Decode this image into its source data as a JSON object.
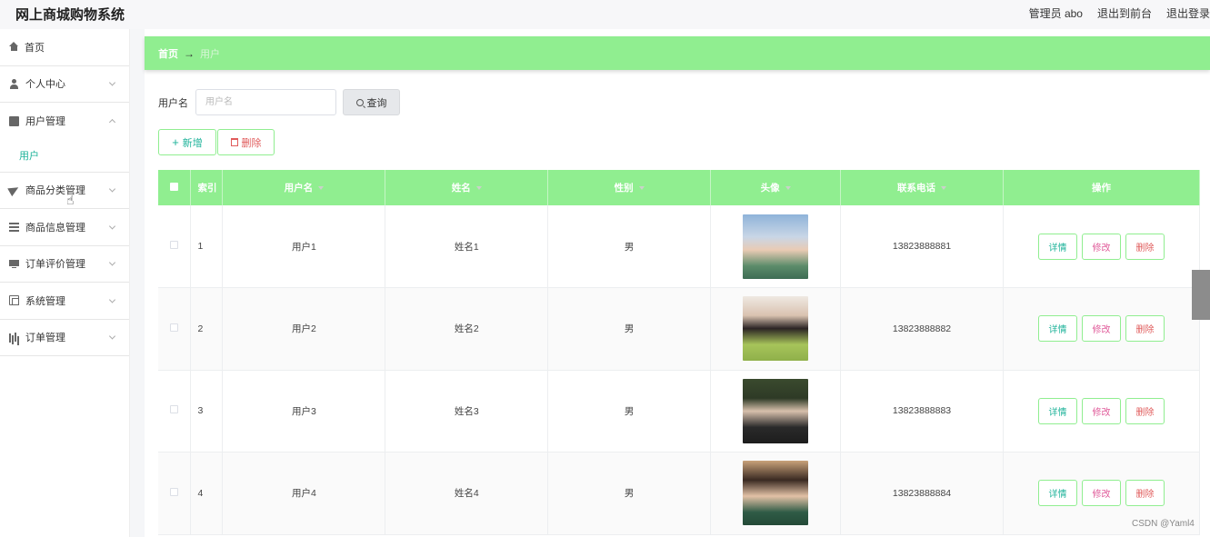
{
  "app": {
    "title": "网上商城购物系统"
  },
  "header": {
    "user": "管理员 abo",
    "to_front": "退出到前台",
    "logout": "退出登录"
  },
  "sidebar": {
    "items": [
      {
        "label": "首页",
        "icon": "home-icon"
      },
      {
        "label": "个人中心",
        "icon": "user-icon"
      },
      {
        "label": "用户管理",
        "icon": "box-icon",
        "expanded": true,
        "sub": [
          "用户"
        ]
      },
      {
        "label": "商品分类管理",
        "icon": "send-icon"
      },
      {
        "label": "商品信息管理",
        "icon": "list-icon"
      },
      {
        "label": "订单评价管理",
        "icon": "monitor-icon"
      },
      {
        "label": "系统管理",
        "icon": "copy-icon"
      },
      {
        "label": "订单管理",
        "icon": "chart-icon"
      }
    ]
  },
  "breadcrumb": {
    "home": "首页",
    "arrow": "→",
    "current": "用户"
  },
  "search": {
    "label": "用户名",
    "placeholder": "用户名",
    "button": "查询"
  },
  "actions": {
    "add": "新增",
    "delete": "删除"
  },
  "table": {
    "columns": [
      "索引",
      "用户名",
      "姓名",
      "性别",
      "头像",
      "联系电话",
      "操作"
    ],
    "rows": [
      {
        "index": "1",
        "username": "用户1",
        "name": "姓名1",
        "gender": "男",
        "phone": "13823888881"
      },
      {
        "index": "2",
        "username": "用户2",
        "name": "姓名2",
        "gender": "男",
        "phone": "13823888882"
      },
      {
        "index": "3",
        "username": "用户3",
        "name": "姓名3",
        "gender": "男",
        "phone": "13823888883"
      },
      {
        "index": "4",
        "username": "用户4",
        "name": "姓名4",
        "gender": "男",
        "phone": "13823888884"
      }
    ],
    "row_actions": {
      "detail": "详情",
      "edit": "修改",
      "remove": "删除"
    }
  },
  "watermark": "CSDN @Yaml4",
  "colors": {
    "accent": "#90ee90",
    "link": "#1fb39a",
    "danger": "#e05b5b"
  }
}
